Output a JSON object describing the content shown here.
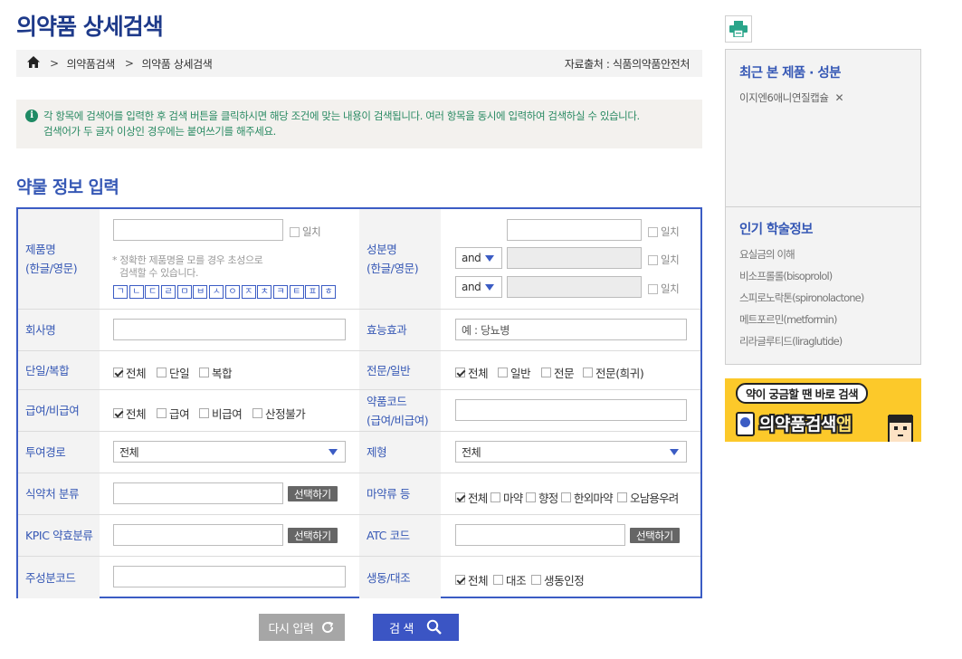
{
  "page": {
    "title": "의약품 상세검색"
  },
  "breadcrumb": {
    "items": [
      "의약품검색",
      "의약품 상세검색"
    ],
    "source": "자료출처 : 식품의약품안전처"
  },
  "info": {
    "line1": "각 항목에 검색어를 입력한 후 검색 버튼을 클릭하시면 해당 조건에 맞는 내용이 검색됩니다. 여러 항목을 동시에 입력하여 검색하실 수 있습니다.",
    "line2": "검색어가 두 글자 이상인 경우에는 붙여쓰기를 해주세요."
  },
  "section": {
    "title": "약물 정보 입력"
  },
  "form": {
    "product_name": {
      "label1": "제품명",
      "label2": "(한글/영문)",
      "exact": "일치",
      "hint1": "* 정확한 제품명을 모를 경우 초성으로",
      "hint2": "검색할 수 있습니다.",
      "jamo": [
        "ㄱ",
        "ㄴ",
        "ㄷ",
        "ㄹ",
        "ㅁ",
        "ㅂ",
        "ㅅ",
        "ㅇ",
        "ㅈ",
        "ㅊ",
        "ㅋ",
        "ㅌ",
        "ㅍ",
        "ㅎ"
      ]
    },
    "ingredient": {
      "label1": "성분명",
      "label2": "(한글/영문)",
      "exact": "일치",
      "op1": "and",
      "op2": "and"
    },
    "company": {
      "label": "회사명"
    },
    "efficacy": {
      "label": "효능효과",
      "placeholder": "예 : 당뇨병"
    },
    "single_combo": {
      "label": "단일/복합",
      "options": [
        "전체",
        "단일",
        "복합"
      ]
    },
    "pro_general": {
      "label": "전문/일반",
      "options": [
        "전체",
        "일반",
        "전문",
        "전문(희귀)"
      ]
    },
    "reimburse": {
      "label": "급여/비급여",
      "options": [
        "전체",
        "급여",
        "비급여",
        "산정불가"
      ]
    },
    "drug_code": {
      "label1": "약품코드",
      "label2": "(급여/비급여)"
    },
    "route": {
      "label": "투여경로",
      "value": "전체"
    },
    "dosage_form": {
      "label": "제형",
      "value": "전체"
    },
    "mfds_class": {
      "label": "식약처 분류",
      "button": "선택하기"
    },
    "narcotics": {
      "label": "마약류 등",
      "options": [
        "전체",
        "마약",
        "향정",
        "한외마약",
        "오남용우려"
      ]
    },
    "kpic_class": {
      "label": "KPIC 약효분류",
      "button": "선택하기"
    },
    "atc_code": {
      "label": "ATC 코드",
      "button": "선택하기"
    },
    "ingredient_code": {
      "label": "주성분코드"
    },
    "bioequiv": {
      "label": "생동/대조",
      "options": [
        "전체",
        "대조",
        "생동인정"
      ]
    }
  },
  "buttons": {
    "reset": "다시 입력",
    "search": "검 색"
  },
  "sidebar": {
    "recent_title": "최근 본 제품 · 성분",
    "recent_items": [
      "이지엔6애니연질캡슐"
    ],
    "popular_title": "인기 학술정보",
    "popular_items": [
      "요실금의 이해",
      "비소프롤롤(bisoprolol)",
      "스피로노락톤(spironolactone)",
      "메트포르민(metformin)",
      "리라글루티드(liraglutide)"
    ]
  },
  "banner": {
    "bubble": "약이 궁금할 땐 바로 검색",
    "app_name": "의약품검색",
    "app_suffix": "앱"
  },
  "colors": {
    "primary": "#3b5cc4",
    "title": "#1e3a8a",
    "info_text": "#2a8a63",
    "banner_bg": "#fcc92a"
  }
}
